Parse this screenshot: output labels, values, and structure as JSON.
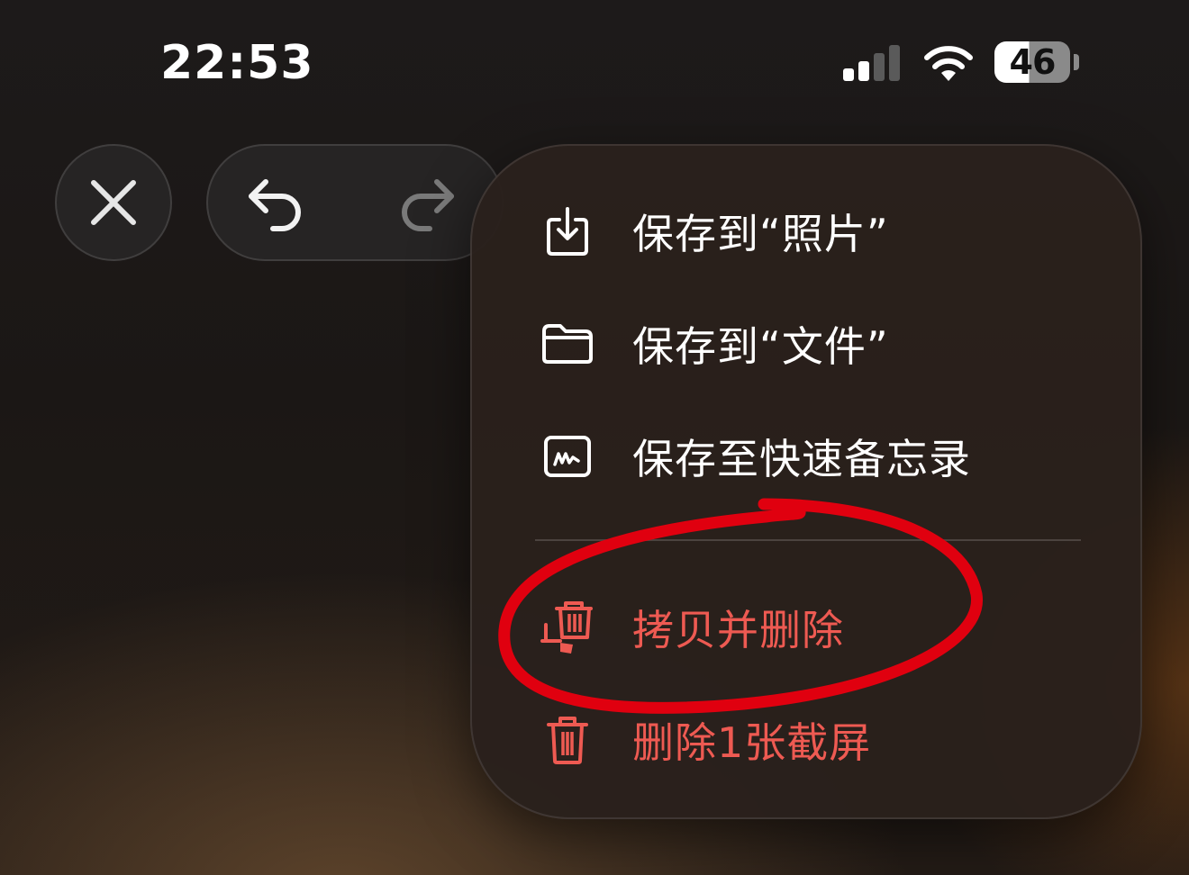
{
  "status_bar": {
    "time": "22:53",
    "battery_level": "46",
    "signal_bars_active": 2,
    "signal_bars_total": 4
  },
  "toolbar": {
    "close_icon": "close-icon",
    "undo_icon": "undo-icon",
    "redo_icon": "redo-icon"
  },
  "menu": {
    "items": [
      {
        "label": "保存到“照片”",
        "icon": "save-to-photos-icon",
        "color": "#ffffff"
      },
      {
        "label": "保存到“文件”",
        "icon": "folder-icon",
        "color": "#ffffff"
      },
      {
        "label": "保存至快速备忘录",
        "icon": "quick-note-icon",
        "color": "#ffffff"
      },
      {
        "label": "拷贝并删除",
        "icon": "copy-and-delete-icon",
        "color": "#ee5a52"
      },
      {
        "label": "删除1张截屏",
        "icon": "trash-icon",
        "color": "#ee5a52"
      }
    ]
  },
  "annotation": {
    "type": "hand-drawn circle",
    "color": "#e0000f"
  }
}
